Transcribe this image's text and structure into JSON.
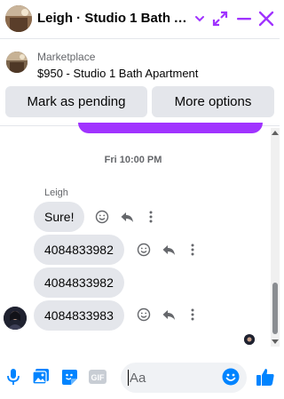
{
  "header": {
    "title": "Leigh · Studio 1 Bath A...",
    "icons": [
      "chevron-down-icon",
      "expand-icon",
      "minimize-icon",
      "close-icon"
    ]
  },
  "listing": {
    "kicker": "Marketplace",
    "title": "$950 - Studio 1 Bath Apartment"
  },
  "actions": {
    "pending": "Mark as pending",
    "more": "More options"
  },
  "conversation": {
    "timestamp": "Fri 10:00 PM",
    "sender": "Leigh",
    "messages": [
      {
        "text": "Sure!"
      },
      {
        "text": "4084833982"
      },
      {
        "text": "4084833982"
      },
      {
        "text": "4084833983"
      }
    ]
  },
  "composer": {
    "placeholder": "Aa",
    "icons": [
      "microphone-icon",
      "photo-icon",
      "sticker-icon",
      "gif-icon",
      "emoji-icon",
      "thumbs-up-icon"
    ]
  },
  "colors": {
    "accent": "#a033ff",
    "messenger_blue": "#0084ff",
    "bubble_gray": "#e4e6eb"
  }
}
